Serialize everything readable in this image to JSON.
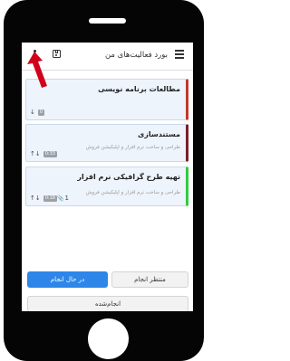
{
  "header": {
    "title": "بورد فعالیت‌های من",
    "menu_icon": "hamburger-menu-icon",
    "save_icon": "save-icon",
    "more_icon": "more-vertical-icon"
  },
  "cards": [
    {
      "title": "مطالعات برنامه نویسی",
      "description": "",
      "badge": "0",
      "accent": "#c0392b",
      "arrows": "↓"
    },
    {
      "title": "مستندسازی",
      "description": "طراحی و ساخت نرم افزار و اپلیکیشن فروش",
      "badge": "0:33",
      "accent": "#7b1f2b",
      "arrows": "↑↓"
    },
    {
      "title": "تهیه طرح گرافیکی نرم افزار",
      "description": "طراحی و ساخت نرم افزار و اپلیکیشن فروش",
      "badge": "0:18",
      "accent": "#2ecc40",
      "arrows": "↑↓",
      "attachments": "1"
    }
  ],
  "buttons": {
    "in_progress": "در حال انجام",
    "waiting": "منتظر انجام",
    "done": "انجام‌شده"
  },
  "colors": {
    "primary": "#2d86e8",
    "annotation_arrow": "#d0021b"
  }
}
